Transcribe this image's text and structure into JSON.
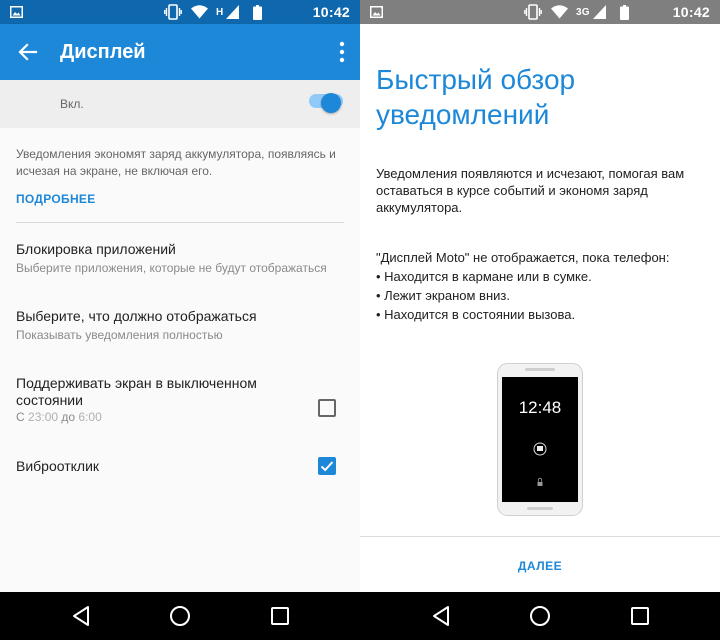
{
  "status_bar": {
    "network_type": "H",
    "secondary_network": "3G",
    "time": "10:42"
  },
  "left": {
    "title": "Дисплей",
    "toggle_label": "Вкл.",
    "toggle_on": true,
    "description": "Уведомления экономят заряд аккумулятора, появляясь и исчезая на экране, не включая его.",
    "more_link": "ПОДРОБНЕЕ",
    "prefs": [
      {
        "title": "Блокировка приложений",
        "subtitle": "Выберите приложения, которые не будут отображаться"
      },
      {
        "title": "Выберите, что должно отображаться",
        "subtitle": "Показывать уведомления полностью"
      },
      {
        "title": "Поддерживать экран в выключенном состоянии",
        "from_label": "С",
        "from_time": "23:00",
        "to_label": "до",
        "to_time": "6:00",
        "checked": false
      },
      {
        "title": "Виброотклик",
        "checked": true
      }
    ]
  },
  "right": {
    "title": "Быстрый обзор уведомлений",
    "paragraph1": "Уведомления появляются и исчезают, помогая вам оставаться в курсе событий и экономя заряд аккумулятора.",
    "paragraph2_intro": "\"Дисплей Moto\" не отображается, пока телефон:",
    "bullets": [
      "• Находится в кармане или в сумке.",
      "• Лежит экраном вниз.",
      "• Находится в состоянии вызова."
    ],
    "phone_time": "12:48",
    "next_button": "ДАЛЕЕ"
  },
  "colors": {
    "accent": "#1e88d8",
    "status_bar_left": "#0f68ad",
    "status_bar_right": "#7f7f7f"
  },
  "icons": {
    "statusbar": [
      "image-notification-icon",
      "vibrate-icon",
      "wifi-icon",
      "signal-icon",
      "battery-icon"
    ],
    "appbar": [
      "back-arrow-icon",
      "more-vert-icon"
    ],
    "navbar": [
      "nav-back-icon",
      "nav-home-icon",
      "nav-recents-icon"
    ]
  }
}
